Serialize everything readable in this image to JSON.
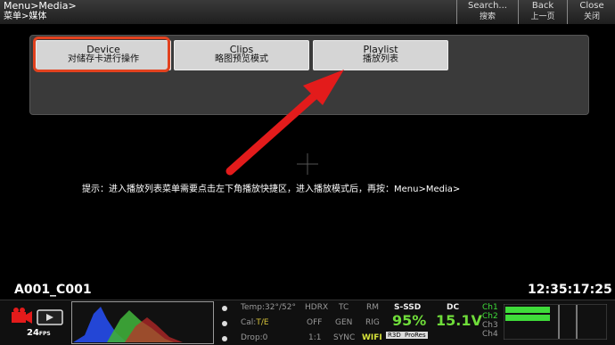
{
  "header": {
    "breadcrumb_en": "Menu>Media>",
    "breadcrumb_cn": "菜单>媒体",
    "buttons": [
      {
        "label": "Search...",
        "sub": "搜索"
      },
      {
        "label": "Back",
        "sub": "上一页"
      },
      {
        "label": "Close",
        "sub": "关闭"
      }
    ]
  },
  "menu": {
    "items": [
      {
        "label": "Device",
        "sub": "对储存卡进行操作",
        "selected": true
      },
      {
        "label": "Clips",
        "sub": "略图预览模式",
        "selected": false
      },
      {
        "label": "Playlist",
        "sub": "播放列表",
        "selected": false
      }
    ]
  },
  "hint": "提示：进入播放列表菜单需要点击左下角播放快捷区，进入播放模式后，再按：Menu>Media>",
  "clip_name": "A001_C001",
  "timecode": "12:35:17:25",
  "fps": "24",
  "fps_unit": "FPS",
  "status": {
    "temp": "Temp:32°/52°",
    "cal_label": "Cal:",
    "cal_value": "T/E",
    "drop": "Drop:0",
    "hdrx": "HDRX",
    "hdrx_val": "OFF",
    "ratio": "1:1",
    "tc": "TC",
    "gen": "GEN",
    "sync": "SYNC",
    "rm": "RM",
    "rig": "RIG",
    "wifi": "WIFI",
    "media_label": "S-SSD",
    "media_value": "95%",
    "format_r3d": "R3D",
    "format_prores": "ProRes",
    "power_label": "DC",
    "power_value": "15.1V",
    "channels": [
      "Ch1",
      "Ch2",
      "Ch3",
      "Ch4"
    ]
  },
  "colors": {
    "highlight": "#e2421f",
    "arrow": "#e31b1b",
    "accent_green": "#6fdc3a"
  }
}
